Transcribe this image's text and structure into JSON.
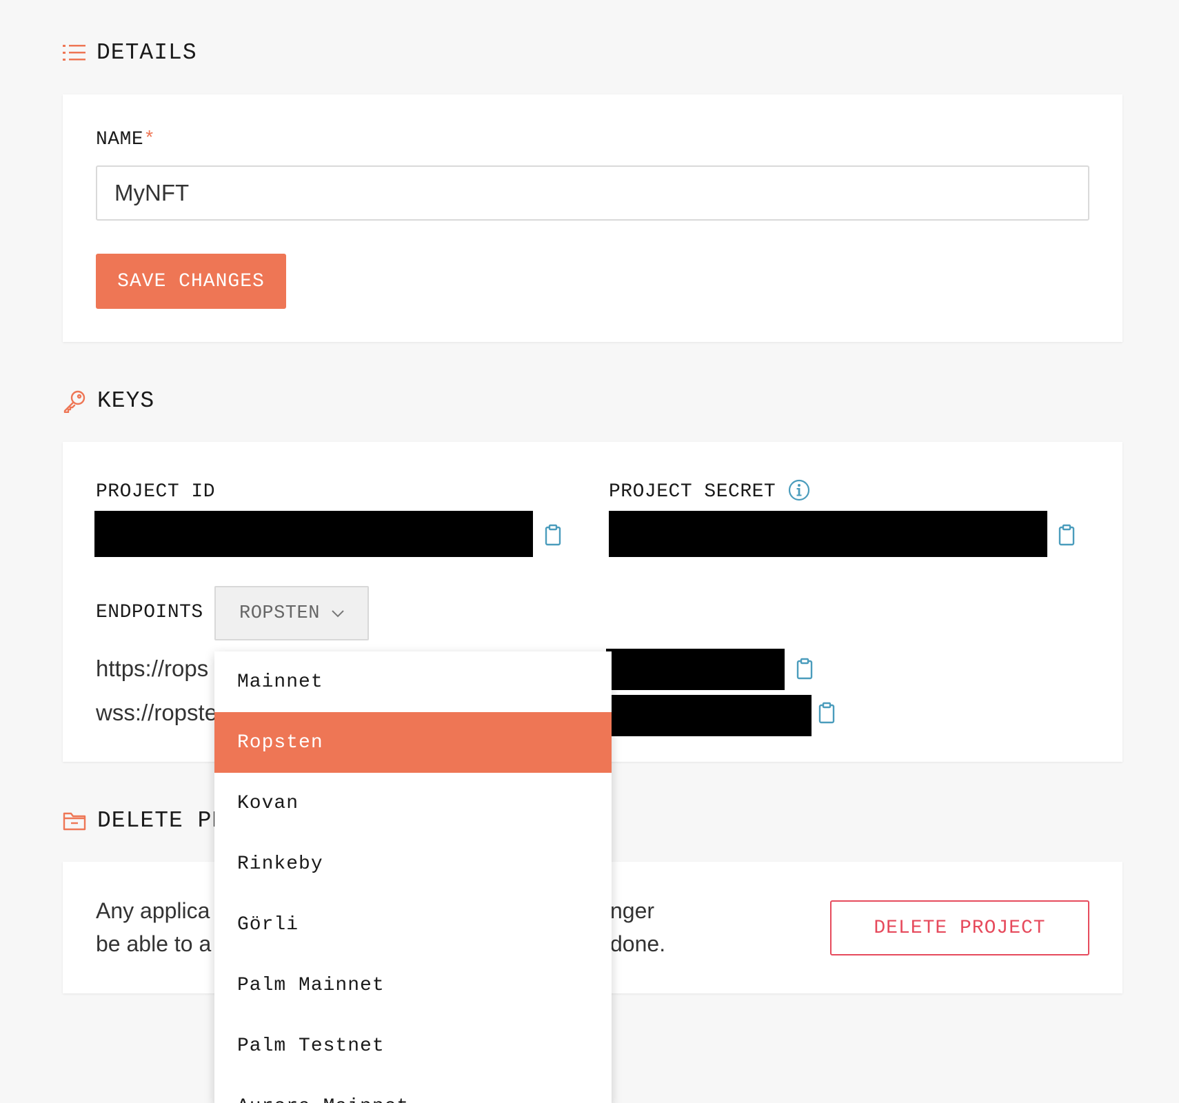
{
  "colors": {
    "accent": "#ee7655",
    "danger": "#e64a5c",
    "clipboard": "#4a9cbc"
  },
  "details": {
    "title": "DETAILS",
    "name_label": "NAME",
    "required_mark": "*",
    "name_value": "MyNFT",
    "save_label": "SAVE CHANGES"
  },
  "keys": {
    "title": "KEYS",
    "project_id_label": "PROJECT ID",
    "project_secret_label": "PROJECT SECRET",
    "endpoints_label": "ENDPOINTS",
    "network_selected": "ROPSTEN",
    "https_endpoint": "https://rops",
    "wss_endpoint": "wss://ropste"
  },
  "delete": {
    "title": "DELETE PR",
    "text_line1_left": "Any applica",
    "text_line1_right": "nger",
    "text_line2_left": "be able to a",
    "text_line2_right": "done.",
    "button_label": "DELETE PROJECT"
  },
  "network_dropdown": {
    "options": [
      {
        "label": "Mainnet",
        "selected": false
      },
      {
        "label": "Ropsten",
        "selected": true
      },
      {
        "label": "Kovan",
        "selected": false
      },
      {
        "label": "Rinkeby",
        "selected": false
      },
      {
        "label": "Görli",
        "selected": false
      },
      {
        "label": "Palm Mainnet",
        "selected": false
      },
      {
        "label": "Palm Testnet",
        "selected": false
      },
      {
        "label": "Aurora Mainnet",
        "selected": false
      }
    ]
  },
  "icons": {
    "details": "list-icon",
    "keys": "key-icon",
    "delete": "folder-icon",
    "info": "info-icon",
    "copy": "clipboard-icon",
    "select": "chevron-down-icon"
  }
}
